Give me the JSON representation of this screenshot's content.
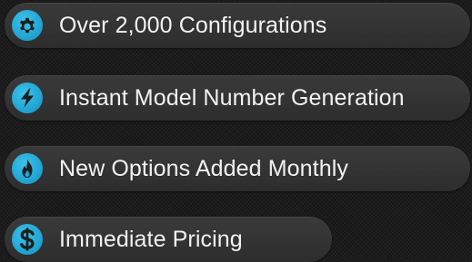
{
  "features": [
    {
      "label": "Over 2,000 Configurations",
      "icon": "gear-icon"
    },
    {
      "label": "Instant Model Number Generation",
      "icon": "lightning-bolt-icon"
    },
    {
      "label": "New Options Added Monthly",
      "icon": "flame-icon"
    },
    {
      "label": "Immediate Pricing",
      "icon": "dollar-sign-icon"
    }
  ],
  "colors": {
    "icon_background": "#22a6d4",
    "icon_glyph": "#1e1e1e",
    "pill_background": "#333333",
    "text": "#f2f2f2",
    "page_background": "#1b1b1b"
  }
}
